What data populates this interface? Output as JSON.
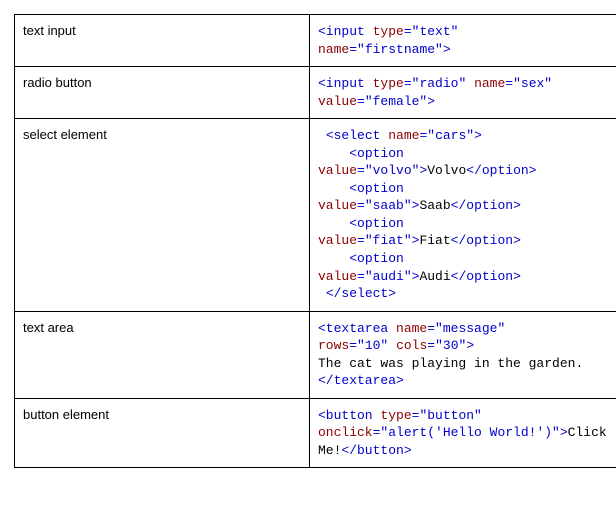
{
  "rows": [
    {
      "label": "text input",
      "code": [
        {
          "c": "t",
          "s": "<input "
        },
        {
          "c": "a",
          "s": "type"
        },
        {
          "c": "t",
          "s": "="
        },
        {
          "c": "v",
          "s": "\"text\""
        },
        {
          "c": "t",
          "s": " "
        },
        {
          "c": "a",
          "s": "\nname"
        },
        {
          "c": "t",
          "s": "="
        },
        {
          "c": "v",
          "s": "\"firstname\""
        },
        {
          "c": "t",
          "s": ">"
        }
      ]
    },
    {
      "label": "radio button",
      "code": [
        {
          "c": "t",
          "s": "<input "
        },
        {
          "c": "a",
          "s": "type"
        },
        {
          "c": "t",
          "s": "="
        },
        {
          "c": "v",
          "s": "\"radio\""
        },
        {
          "c": "t",
          "s": " "
        },
        {
          "c": "a",
          "s": "name"
        },
        {
          "c": "t",
          "s": "="
        },
        {
          "c": "v",
          "s": "\"sex\""
        },
        {
          "c": "t",
          "s": " "
        },
        {
          "c": "a",
          "s": "\nvalue"
        },
        {
          "c": "t",
          "s": "="
        },
        {
          "c": "v",
          "s": "\"female\""
        },
        {
          "c": "t",
          "s": ">"
        }
      ]
    },
    {
      "label": "select element",
      "code": [
        {
          "c": "t",
          "s": " <select "
        },
        {
          "c": "a",
          "s": "name"
        },
        {
          "c": "t",
          "s": "="
        },
        {
          "c": "v",
          "s": "\"cars\""
        },
        {
          "c": "t",
          "s": ">"
        },
        {
          "c": "t",
          "s": "\n    <option "
        },
        {
          "c": "a",
          "s": "\nvalue"
        },
        {
          "c": "t",
          "s": "="
        },
        {
          "c": "v",
          "s": "\"volvo\""
        },
        {
          "c": "t",
          "s": ">"
        },
        {
          "c": "tx",
          "s": "Volvo"
        },
        {
          "c": "t",
          "s": "</option>"
        },
        {
          "c": "t",
          "s": "\n    <option "
        },
        {
          "c": "a",
          "s": "\nvalue"
        },
        {
          "c": "t",
          "s": "="
        },
        {
          "c": "v",
          "s": "\"saab\""
        },
        {
          "c": "t",
          "s": ">"
        },
        {
          "c": "tx",
          "s": "Saab"
        },
        {
          "c": "t",
          "s": "</option>"
        },
        {
          "c": "t",
          "s": "\n    <option "
        },
        {
          "c": "a",
          "s": "\nvalue"
        },
        {
          "c": "t",
          "s": "="
        },
        {
          "c": "v",
          "s": "\"fiat\""
        },
        {
          "c": "t",
          "s": ">"
        },
        {
          "c": "tx",
          "s": "Fiat"
        },
        {
          "c": "t",
          "s": "</option>"
        },
        {
          "c": "t",
          "s": "\n    <option "
        },
        {
          "c": "a",
          "s": "\nvalue"
        },
        {
          "c": "t",
          "s": "="
        },
        {
          "c": "v",
          "s": "\"audi\""
        },
        {
          "c": "t",
          "s": ">"
        },
        {
          "c": "tx",
          "s": "Audi"
        },
        {
          "c": "t",
          "s": "</option>"
        },
        {
          "c": "t",
          "s": "\n </select>"
        }
      ]
    },
    {
      "label": "text area",
      "code": [
        {
          "c": "t",
          "s": "<textarea "
        },
        {
          "c": "a",
          "s": "name"
        },
        {
          "c": "t",
          "s": "="
        },
        {
          "c": "v",
          "s": "\"message\""
        },
        {
          "c": "t",
          "s": " "
        },
        {
          "c": "a",
          "s": "\nrows"
        },
        {
          "c": "t",
          "s": "="
        },
        {
          "c": "v",
          "s": "\"10\""
        },
        {
          "c": "t",
          "s": " "
        },
        {
          "c": "a",
          "s": "cols"
        },
        {
          "c": "t",
          "s": "="
        },
        {
          "c": "v",
          "s": "\"30\""
        },
        {
          "c": "t",
          "s": ">"
        },
        {
          "c": "tx",
          "s": "\nThe cat was playing in the garden.\n"
        },
        {
          "c": "t",
          "s": "</textarea>"
        }
      ]
    },
    {
      "label": "button element",
      "code": [
        {
          "c": "t",
          "s": "<button "
        },
        {
          "c": "a",
          "s": "type"
        },
        {
          "c": "t",
          "s": "="
        },
        {
          "c": "v",
          "s": "\"button\""
        },
        {
          "c": "t",
          "s": " "
        },
        {
          "c": "a",
          "s": "\nonclick"
        },
        {
          "c": "t",
          "s": "="
        },
        {
          "c": "v",
          "s": "\"alert('Hello World!')\""
        },
        {
          "c": "t",
          "s": ">"
        },
        {
          "c": "tx",
          "s": "Click Me!"
        },
        {
          "c": "t",
          "s": "</button>"
        }
      ]
    }
  ]
}
